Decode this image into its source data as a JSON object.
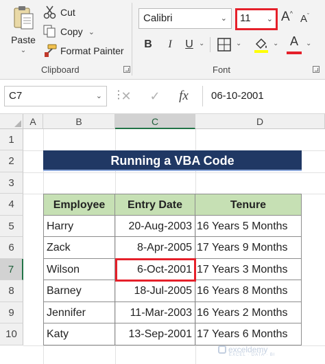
{
  "ribbon": {
    "clipboard": {
      "paste_label": "Paste",
      "cut_label": "Cut",
      "copy_label": "Copy",
      "format_painter_label": "Format Painter",
      "group_label": "Clipboard"
    },
    "font": {
      "font_name": "Calibri",
      "font_size": "11",
      "group_label": "Font",
      "bold": "B",
      "italic": "I",
      "underline": "U",
      "font_color_glyph": "A",
      "font_color": "#e5202a"
    }
  },
  "formula_bar": {
    "name_box": "C7",
    "fx_label": "fx",
    "formula_value": "06-10-2001"
  },
  "grid": {
    "columns": [
      "A",
      "B",
      "C",
      "D"
    ],
    "active_column": "C",
    "rows": [
      "1",
      "2",
      "3",
      "4",
      "5",
      "6",
      "7",
      "8",
      "9",
      "10"
    ],
    "active_row": "7"
  },
  "sheet": {
    "title": "Running a VBA Code",
    "headers": [
      "Employee",
      "Entry Date",
      "Tenure"
    ],
    "data_rows": [
      [
        "Harry",
        "20-Aug-2003",
        "16 Years 5 Months"
      ],
      [
        "Zack",
        "8-Apr-2005",
        "17 Years 9 Months"
      ],
      [
        "Wilson",
        "6-Oct-2001",
        "17 Years 3 Months"
      ],
      [
        "Barney",
        "18-Jul-2005",
        "16 Years 8 Months"
      ],
      [
        "Jennifer",
        "11-Mar-2003",
        "16 Years 2 Months"
      ],
      [
        "Katy",
        "13-Sep-2001",
        "17 Years 6 Months"
      ]
    ],
    "selected_cell": "C7"
  },
  "watermark": {
    "name": "exceldemy",
    "tagline": "EXCEL · DATA · BI"
  },
  "colors": {
    "title_banner": "#203864",
    "header_fill": "#c6e0b4",
    "highlight": "#e5202a",
    "excel_green": "#217346"
  }
}
